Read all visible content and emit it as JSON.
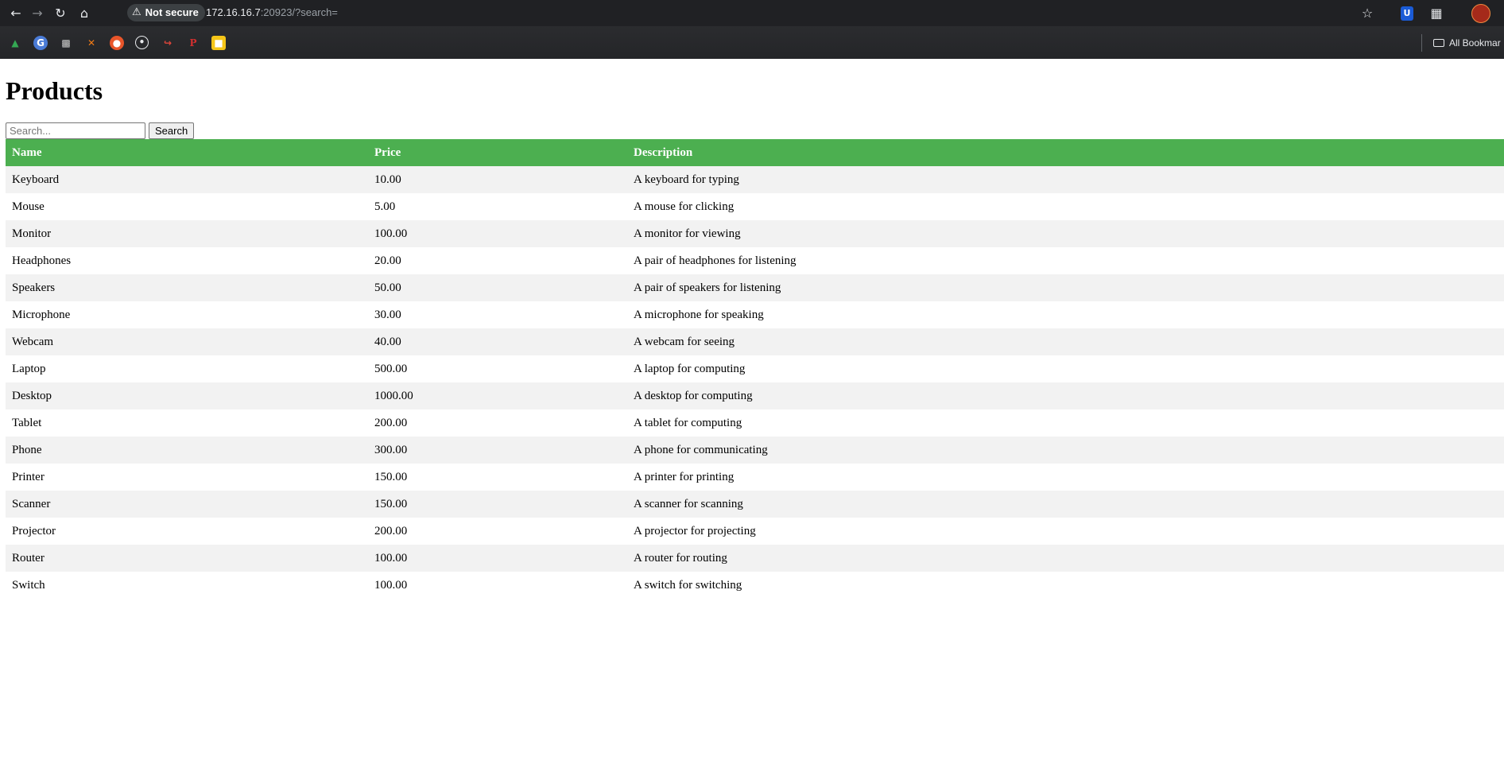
{
  "browser": {
    "security_label": "Not secure",
    "url_host": "172.16.16.7",
    "url_rest": ":20923/?search=",
    "all_bookmarks_label": "All Bookmar"
  },
  "page": {
    "title": "Products",
    "search_placeholder": "Search...",
    "search_value": "",
    "search_button": "Search"
  },
  "table": {
    "headers": [
      "Name",
      "Price",
      "Description"
    ],
    "rows": [
      [
        "Keyboard",
        "10.00",
        "A keyboard for typing"
      ],
      [
        "Mouse",
        "5.00",
        "A mouse for clicking"
      ],
      [
        "Monitor",
        "100.00",
        "A monitor for viewing"
      ],
      [
        "Headphones",
        "20.00",
        "A pair of headphones for listening"
      ],
      [
        "Speakers",
        "50.00",
        "A pair of speakers for listening"
      ],
      [
        "Microphone",
        "30.00",
        "A microphone for speaking"
      ],
      [
        "Webcam",
        "40.00",
        "A webcam for seeing"
      ],
      [
        "Laptop",
        "500.00",
        "A laptop for computing"
      ],
      [
        "Desktop",
        "1000.00",
        "A desktop for computing"
      ],
      [
        "Tablet",
        "200.00",
        "A tablet for computing"
      ],
      [
        "Phone",
        "300.00",
        "A phone for communicating"
      ],
      [
        "Printer",
        "150.00",
        "A printer for printing"
      ],
      [
        "Scanner",
        "150.00",
        "A scanner for scanning"
      ],
      [
        "Projector",
        "200.00",
        "A projector for projecting"
      ],
      [
        "Router",
        "100.00",
        "A router for routing"
      ],
      [
        "Switch",
        "100.00",
        "A switch for switching"
      ]
    ]
  },
  "colors": {
    "header_green": "#4caf50",
    "stripe": "#f2f2f2",
    "chrome_dark": "#202124"
  },
  "icons": {
    "toolbar": [
      "back-icon",
      "forward-icon",
      "reload-icon",
      "home-icon",
      "warning-icon",
      "star-icon",
      "bitwarden-icon",
      "extensions-icon",
      "profile-avatar-icon"
    ],
    "bookmarks": [
      "google-drive-icon",
      "bookmark-g-icon",
      "bookmark-printer-icon",
      "bookmark-x-icon",
      "bookmark-firefox-icon",
      "bookmark-circle-icon",
      "bookmark-arrow-icon",
      "bookmark-p-icon",
      "bookmark-yellow-icon",
      "folder-icon"
    ]
  }
}
